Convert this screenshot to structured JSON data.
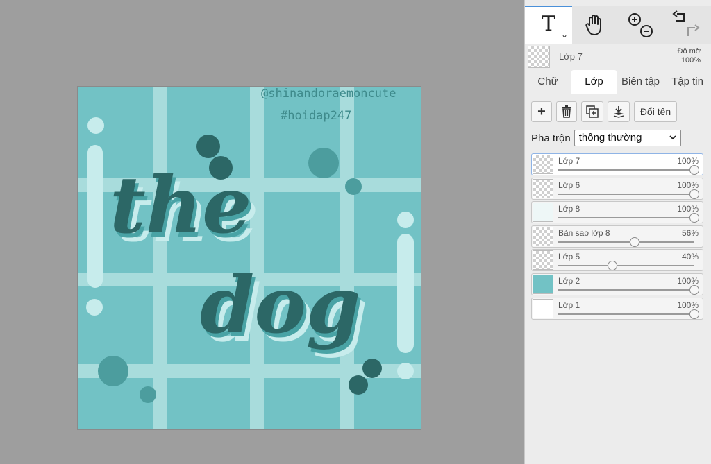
{
  "toolbar": {
    "text_tool_glyph": "T",
    "text_tool_chevron": "⌄",
    "hand_icon": "hand-icon",
    "zoom_in_icon": "zoom-in-icon",
    "zoom_out_icon": "zoom-out-icon",
    "undo_icon": "undo-icon",
    "redo_icon": "redo-icon"
  },
  "current_layer": {
    "name": "Lớp 7",
    "opacity_label": "Độ mờ",
    "opacity_value": "100%"
  },
  "tabs": [
    {
      "label": "Chữ",
      "active": false
    },
    {
      "label": "Lớp",
      "active": true
    },
    {
      "label": "Biên tập",
      "active": false
    },
    {
      "label": "Tập tin",
      "active": false
    }
  ],
  "layer_buttons": {
    "add": "+",
    "rename": "Đổi tên"
  },
  "blend": {
    "label": "Pha trộn",
    "value": "thông thường"
  },
  "layers": [
    {
      "name": "Lớp 7",
      "value": "100%",
      "opacity": 1.0,
      "selected": true
    },
    {
      "name": "Lớp 6",
      "value": "100%",
      "opacity": 1.0,
      "selected": false
    },
    {
      "name": "Lớp 8",
      "value": "100%",
      "opacity": 1.0,
      "selected": false
    },
    {
      "name": "Bản sao lớp 8",
      "value": "56%",
      "opacity": 0.56,
      "selected": false
    },
    {
      "name": "Lớp 5",
      "value": "40%",
      "opacity": 0.4,
      "selected": false
    },
    {
      "name": "Lớp 2",
      "value": "100%",
      "opacity": 1.0,
      "selected": false
    },
    {
      "name": "Lớp 1",
      "value": "100%",
      "opacity": 1.0,
      "selected": false
    }
  ],
  "canvas": {
    "watermark_line1": "@shinandoraemoncute",
    "watermark_line2": "#hoidap247",
    "word1": "the",
    "word2": "dog",
    "colors": {
      "background": "#72c2c5",
      "grid": "#a8dcdc",
      "dark": "#2c6766",
      "mid": "#49a3a5",
      "light": "#c7ecec"
    }
  }
}
